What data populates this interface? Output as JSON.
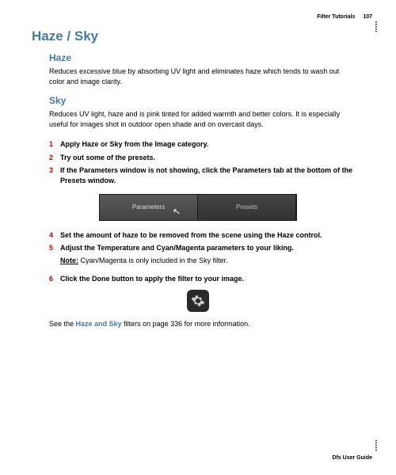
{
  "header": {
    "section": "Filter Tutorials",
    "page": "107"
  },
  "title": "Haze / Sky",
  "haze": {
    "heading": "Haze",
    "body": "Reduces excessive blue by absorbing UV light and eliminates haze which tends to wash out color and image clarity."
  },
  "sky": {
    "heading": "Sky",
    "body": "Reduces UV light, haze and is pink tinted for added warmth and better colors. It is especially useful for images shot in outdoor open shade and on overcast days."
  },
  "steps": [
    {
      "n": "1",
      "text": "Apply Haze or Sky from the Image category."
    },
    {
      "n": "2",
      "text": "Try out some of the presets."
    },
    {
      "n": "3",
      "text": "If the Parameters window is not showing, click the Parameters tab at the bottom of the Presets window."
    },
    {
      "n": "4",
      "text": "Set the amount of haze to be removed from the scene using the Haze control."
    },
    {
      "n": "5",
      "text": "Adjust the Temperature and Cyan/Magenta parameters to your liking."
    },
    {
      "n": "6",
      "text": "Click the Done button to apply the filter to your image."
    }
  ],
  "tabs": {
    "parameters": "Parameters",
    "presets": "Presets"
  },
  "note": {
    "label": "Note:",
    "text": " Cyan/Magenta is only included in the Sky filter."
  },
  "see": {
    "prefix": "See the ",
    "link": "Haze and Sky",
    "suffix": " filters on page 336 for more information."
  },
  "footer": "Dfx User Guide"
}
